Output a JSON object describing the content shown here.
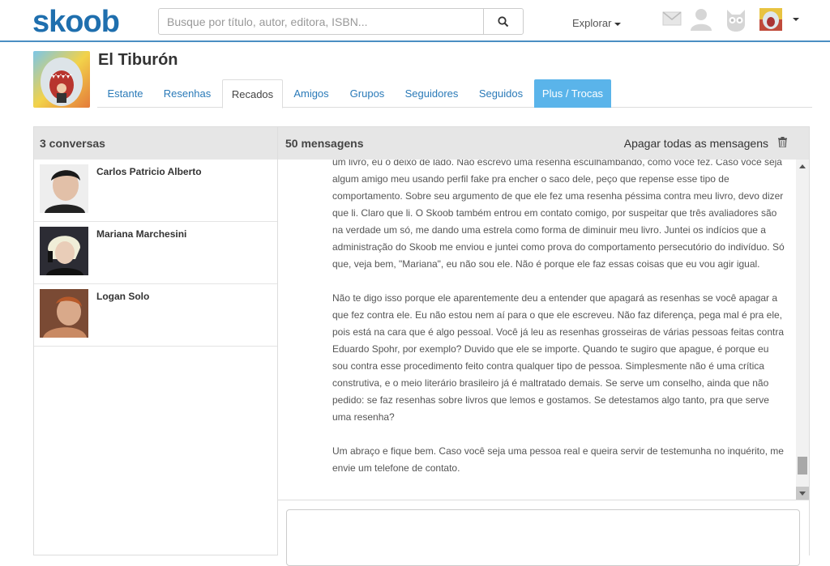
{
  "header": {
    "logo": "skoob",
    "search_placeholder": "Busque por título, autor, editora, ISBN...",
    "explore_label": "Explorar"
  },
  "profile": {
    "name": "El Tiburón",
    "tabs": [
      {
        "label": "Estante"
      },
      {
        "label": "Resenhas"
      },
      {
        "label": "Recados"
      },
      {
        "label": "Amigos"
      },
      {
        "label": "Grupos"
      },
      {
        "label": "Seguidores"
      },
      {
        "label": "Seguidos"
      },
      {
        "label": "Plus / Trocas"
      }
    ],
    "active_tab": "Recados"
  },
  "conversations": {
    "header": "3 conversas",
    "items": [
      {
        "name": "Carlos Patricio Alberto"
      },
      {
        "name": "Mariana Marchesini"
      },
      {
        "name": "Logan Solo"
      }
    ]
  },
  "messages": {
    "header": "50 mensagens",
    "delete_all_label": "Apagar todas as mensagens",
    "paragraphs": [
      "um livro, eu o deixo de lado. Não escrevo uma resenha esculhambando, como você fez. Caso você seja algum amigo meu usando perfil fake pra encher o saco dele, peço que repense esse tipo de comportamento. Sobre seu argumento de que ele fez uma resenha péssima contra meu livro, devo dizer que li. Claro que li. O Skoob também entrou em contato comigo, por suspeitar que três avaliadores são na verdade um só, me dando uma estrela como forma de diminuir meu livro. Juntei os indícios que a administração do Skoob me enviou e juntei como prova do comportamento persecutório do indivíduo. Só que, veja bem, \"Mariana\", eu não sou ele. Não é porque ele faz essas coisas que eu vou agir igual.",
      "Não te digo isso porque ele aparentemente deu a entender que apagará as resenhas se você apagar a que fez contra ele. Eu não estou nem aí para o que ele escreveu. Não faz diferença, pega mal é pra ele, pois está na cara que é algo pessoal. Você já leu as resenhas grosseiras de várias pessoas feitas contra Eduardo Spohr, por exemplo? Duvido que ele se importe. Quando te sugiro que apague, é porque eu sou contra esse procedimento feito contra qualquer tipo de pessoa. Simplesmente não é uma crítica construtiva, e o meio literário brasileiro já é maltratado demais. Se serve um conselho, ainda que não pedido: se faz resenhas sobre livros que lemos e gostamos. Se detestamos algo tanto, pra que serve uma resenha?",
      "Um abraço e fique bem. Caso você seja uma pessoa real e queira servir de testemunha no inquérito, me envie um telefone de contato."
    ]
  },
  "colors": {
    "brand": "#1f6fae",
    "link": "#2a7ab8",
    "plus_tab": "#5ab4ea"
  }
}
